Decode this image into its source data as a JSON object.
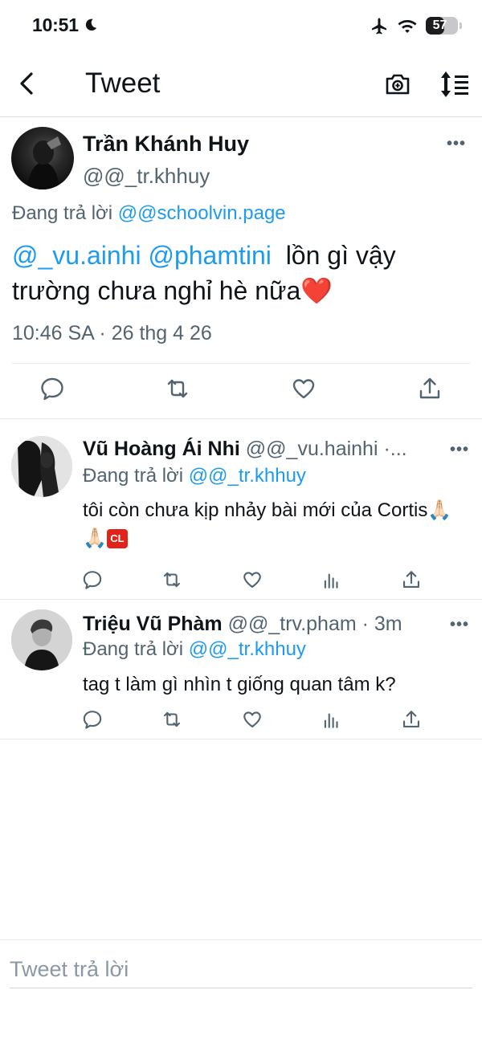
{
  "status_bar": {
    "time": "10:51",
    "battery": "57",
    "battery_level_percent": 57
  },
  "nav": {
    "title": "Tweet"
  },
  "main_tweet": {
    "name": "Trần Khánh Huy",
    "handle": "@@_tr.khhuy",
    "replying_prefix": "Đang trả lời",
    "replying_to": "@@schoolvin.page",
    "mention_1": "@_vu.ainhi",
    "mention_2": "@phamtini",
    "text": "lồn gì vậy trường chưa nghỉ hè nữa",
    "emoji": "❤️",
    "timestamp": "10:46 SA · 26 thg 4 26"
  },
  "replies": [
    {
      "name": "Vũ Hoàng Ái Nhi",
      "meta": "@@_vu.hainhi ·...",
      "replying_prefix": "Đang trả lời",
      "replying_to": "@@_tr.khhuy",
      "text": "tôi còn chưa kịp nhảy bài mới của Cortis",
      "emoji": "🙏🏻🙏🏻",
      "badge": "CL"
    },
    {
      "name": "Triệu Vũ Phàm",
      "meta": "@@_trv.pham · 3m",
      "replying_prefix": "Đang trả lời",
      "replying_to": "@@_tr.khhuy",
      "text": "tag t làm gì nhìn t giống quan tâm k?"
    }
  ],
  "composer": {
    "placeholder": "Tweet trả lời"
  },
  "colors": {
    "accent": "#1d9bf0",
    "muted": "#536471",
    "text": "#0f1419"
  }
}
